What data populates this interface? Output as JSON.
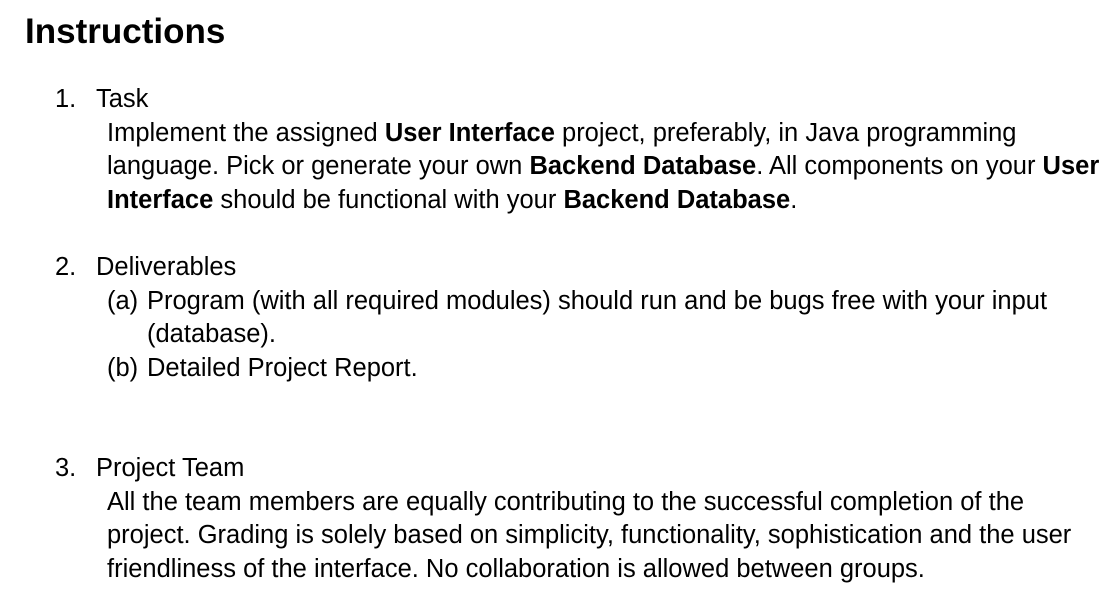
{
  "heading": "Instructions",
  "items": [
    {
      "number": "1.",
      "title": "Task",
      "body": [
        {
          "text": "Implement the assigned ",
          "bold": false
        },
        {
          "text": "User Interface",
          "bold": true
        },
        {
          "text": " project, preferably, in Java programming language. Pick or generate your own ",
          "bold": false
        },
        {
          "text": "Backend Database",
          "bold": true
        },
        {
          "text": ". All components on your ",
          "bold": false
        },
        {
          "text": "User Interface",
          "bold": true
        },
        {
          "text": " should be functional with your ",
          "bold": false
        },
        {
          "text": "Backend Database",
          "bold": true
        },
        {
          "text": ".",
          "bold": false
        }
      ]
    },
    {
      "number": "2.",
      "title": "Deliverables",
      "subitems": [
        {
          "marker": "(a)",
          "text": "Program (with all required modules) should run and be bugs free with your input (database)."
        },
        {
          "marker": "(b)",
          "text": "Detailed Project Report."
        }
      ]
    },
    {
      "number": "3.",
      "title": "Project Team",
      "body": "All the team members are equally contributing to the successful completion of the project. Grading is solely based on simplicity, functionality, sophistication and the user friendliness of the interface. No collaboration is allowed between groups."
    }
  ]
}
